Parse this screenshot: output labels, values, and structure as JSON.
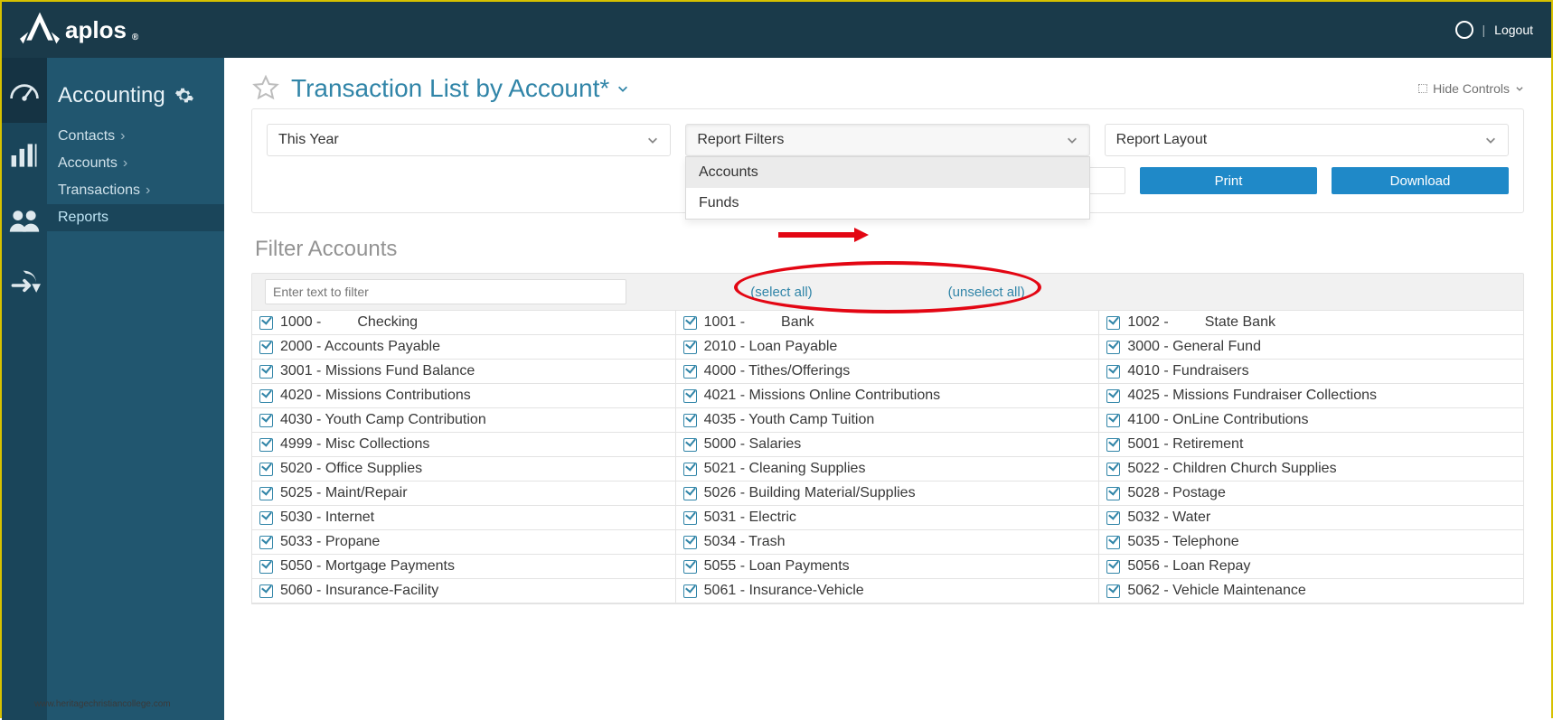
{
  "header": {
    "brand": "aplos",
    "logout": "Logout"
  },
  "sidebar": {
    "title": "Accounting",
    "links": [
      {
        "label": "Contacts",
        "active": false
      },
      {
        "label": "Accounts",
        "active": false
      },
      {
        "label": "Transactions",
        "active": false
      },
      {
        "label": "Reports",
        "active": true
      }
    ]
  },
  "page": {
    "title": "Transaction List by Account*",
    "hide_controls": "Hide Controls"
  },
  "controls": {
    "period": "This Year",
    "filters_label": "Report Filters",
    "layout_label": "Report Layout",
    "print": "Print",
    "download": "Download",
    "dropdown": [
      "Accounts",
      "Funds"
    ]
  },
  "filters": {
    "title": "Filter Accounts",
    "placeholder": "Enter text to filter",
    "select_all": "(select all)",
    "unselect_all": "(unselect all)"
  },
  "accounts": [
    {
      "code": "1000",
      "name": "Checking",
      "pad": true
    },
    {
      "code": "1001",
      "name": "Bank",
      "pad": true
    },
    {
      "code": "1002",
      "name": "State Bank",
      "pad": true
    },
    {
      "code": "2000",
      "name": "Accounts Payable"
    },
    {
      "code": "2010",
      "name": "Loan Payable"
    },
    {
      "code": "3000",
      "name": "General Fund"
    },
    {
      "code": "3001",
      "name": "Missions Fund Balance"
    },
    {
      "code": "4000",
      "name": "Tithes/Offerings"
    },
    {
      "code": "4010",
      "name": "Fundraisers"
    },
    {
      "code": "4020",
      "name": "Missions Contributions"
    },
    {
      "code": "4021",
      "name": "Missions Online Contributions"
    },
    {
      "code": "4025",
      "name": "Missions Fundraiser Collections"
    },
    {
      "code": "4030",
      "name": "Youth Camp Contribution"
    },
    {
      "code": "4035",
      "name": "Youth Camp Tuition"
    },
    {
      "code": "4100",
      "name": "OnLine Contributions"
    },
    {
      "code": "4999",
      "name": "Misc Collections"
    },
    {
      "code": "5000",
      "name": "Salaries"
    },
    {
      "code": "5001",
      "name": "Retirement"
    },
    {
      "code": "5020",
      "name": "Office Supplies"
    },
    {
      "code": "5021",
      "name": "Cleaning Supplies"
    },
    {
      "code": "5022",
      "name": "Children Church Supplies"
    },
    {
      "code": "5025",
      "name": "Maint/Repair"
    },
    {
      "code": "5026",
      "name": "Building Material/Supplies"
    },
    {
      "code": "5028",
      "name": "Postage"
    },
    {
      "code": "5030",
      "name": "Internet"
    },
    {
      "code": "5031",
      "name": "Electric"
    },
    {
      "code": "5032",
      "name": "Water"
    },
    {
      "code": "5033",
      "name": "Propane"
    },
    {
      "code": "5034",
      "name": "Trash"
    },
    {
      "code": "5035",
      "name": "Telephone"
    },
    {
      "code": "5050",
      "name": "Mortgage Payments"
    },
    {
      "code": "5055",
      "name": "Loan Payments"
    },
    {
      "code": "5056",
      "name": "Loan Repay"
    },
    {
      "code": "5060",
      "name": "Insurance-Facility"
    },
    {
      "code": "5061",
      "name": "Insurance-Vehicle"
    },
    {
      "code": "5062",
      "name": "Vehicle Maintenance"
    }
  ],
  "watermark": "www.heritagechristiancollege.com"
}
